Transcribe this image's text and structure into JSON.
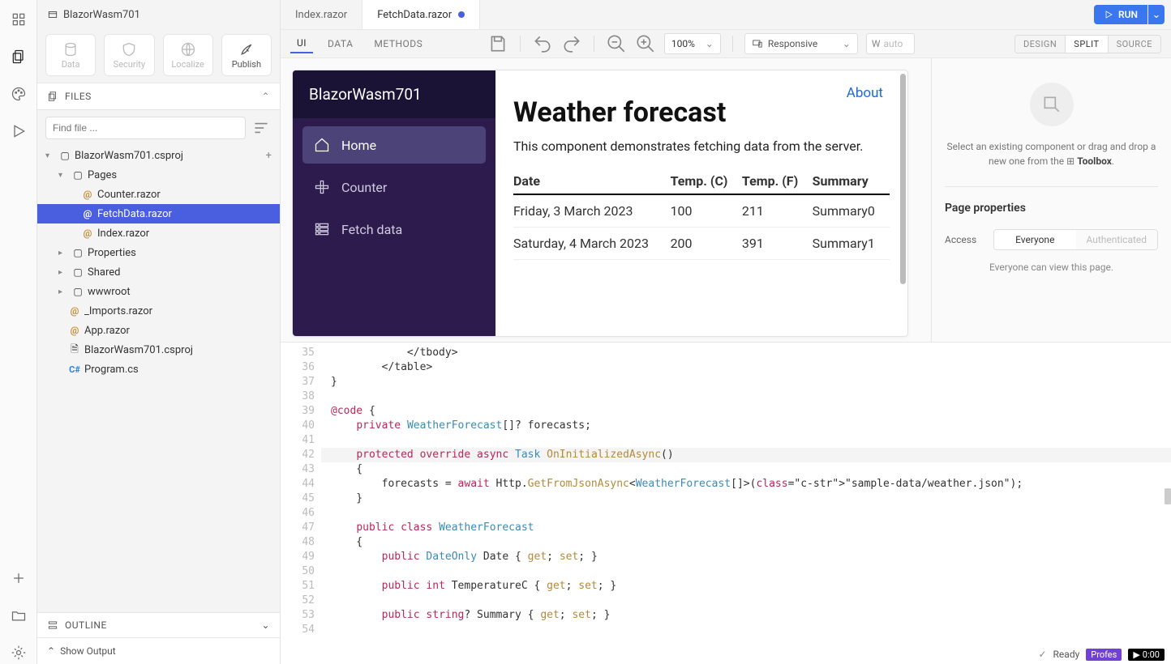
{
  "project": {
    "name": "BlazorWasm701"
  },
  "activity": {
    "items": [
      "components",
      "files",
      "palette",
      "run"
    ],
    "bottom": [
      "add",
      "open",
      "settings"
    ]
  },
  "toolbar": {
    "data": "Data",
    "security": "Security",
    "localize": "Localize",
    "publish": "Publish"
  },
  "filesSection": {
    "title": "FILES"
  },
  "search": {
    "placeholder": "Find file ..."
  },
  "tree": {
    "root": "BlazorWasm701.csproj",
    "pages": "Pages",
    "counter": "Counter.razor",
    "fetchdata": "FetchData.razor",
    "index": "Index.razor",
    "properties": "Properties",
    "shared": "Shared",
    "wwwroot": "wwwroot",
    "imports": "_Imports.razor",
    "app": "App.razor",
    "csproj": "BlazorWasm701.csproj",
    "program": "Program.cs"
  },
  "outline": {
    "title": "OUTLINE"
  },
  "showOutput": "Show Output",
  "tabs": {
    "index": "Index.razor",
    "fetchdata": "FetchData.razor",
    "run": "RUN"
  },
  "modes": {
    "ui": "UI",
    "data": "DATA",
    "methods": "METHODS"
  },
  "zoom": "100%",
  "device": "Responsive",
  "widthLabel": "W",
  "widthValue": "auto",
  "viewModes": {
    "design": "DESIGN",
    "split": "SPLIT",
    "source": "SOURCE"
  },
  "preview": {
    "brand": "BlazorWasm701",
    "nav": {
      "home": "Home",
      "counter": "Counter",
      "fetchdata": "Fetch data"
    },
    "about": "About",
    "heading": "Weather forecast",
    "subtitle": "This component demonstrates fetching data from the server.",
    "headers": {
      "date": "Date",
      "tempc": "Temp. (C)",
      "tempf": "Temp. (F)",
      "summary": "Summary"
    },
    "rows": [
      {
        "date": "Friday, 3 March 2023",
        "tc": "100",
        "tf": "211",
        "sum": "Summary0"
      },
      {
        "date": "Saturday, 4 March 2023",
        "tc": "200",
        "tf": "391",
        "sum": "Summary1"
      }
    ]
  },
  "properties": {
    "hint1": "Select an existing component or drag and drop a new one from the",
    "hintIcon": "⊞",
    "hintBold": "Toolbox",
    "title": "Page properties",
    "accessLabel": "Access",
    "everyone": "Everyone",
    "authenticated": "Authenticated",
    "note": "Everyone can view this page."
  },
  "code": {
    "startLine": 35,
    "lines": [
      "            </tbody>",
      "        </table>",
      "}",
      "",
      "@code {",
      "    private WeatherForecast[]? forecasts;",
      "",
      "    protected override async Task OnInitializedAsync()",
      "    {",
      "        forecasts = await Http.GetFromJsonAsync<WeatherForecast[]>(\"sample-data/weather.json\");",
      "    }",
      "",
      "    public class WeatherForecast",
      "    {",
      "        public DateOnly Date { get; set; }",
      "",
      "        public int TemperatureC { get; set; }",
      "",
      "        public string? Summary { get; set; }",
      ""
    ],
    "highlightLine": 42
  },
  "status": {
    "ready": "Ready",
    "plan": "Profes",
    "time": "0:00"
  }
}
